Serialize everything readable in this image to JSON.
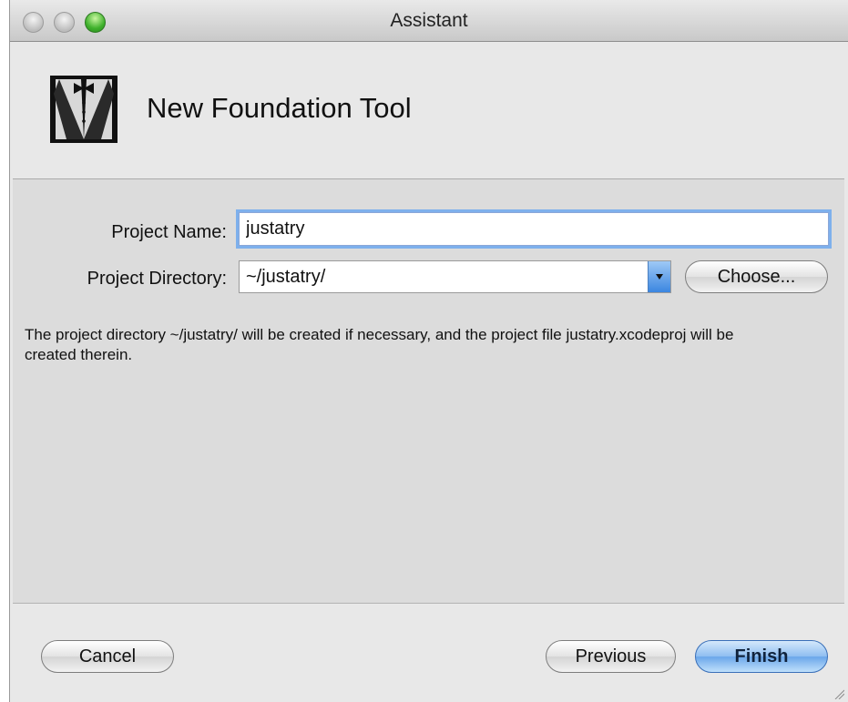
{
  "window": {
    "title": "Assistant"
  },
  "header": {
    "title": "New Foundation Tool",
    "icon": "tuxedo-icon"
  },
  "form": {
    "project_name_label": "Project Name:",
    "project_name_value": "justatry",
    "project_directory_label": "Project Directory:",
    "project_directory_value": "~/justatry/",
    "choose_label": "Choose...",
    "description": "The project directory ~/justatry/ will be created if necessary, and the project file justatry.xcodeproj will be created therein."
  },
  "footer": {
    "cancel_label": "Cancel",
    "previous_label": "Previous",
    "finish_label": "Finish"
  },
  "colors": {
    "accent": "#6aa6ea",
    "zoom_button": "#3fb12c"
  }
}
